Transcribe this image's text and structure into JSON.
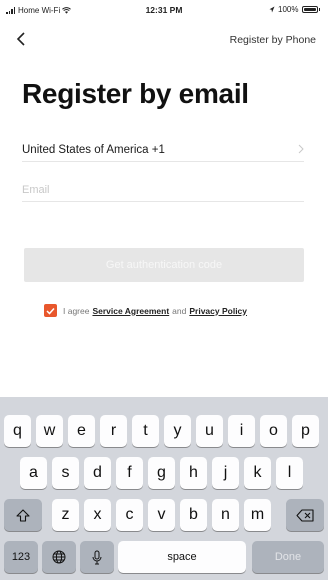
{
  "status_bar": {
    "carrier": "Home Wi-Fi",
    "time": "12:31 PM",
    "battery": "100%"
  },
  "nav": {
    "back_icon": "chevron-left-icon",
    "right_link": "Register by Phone"
  },
  "page": {
    "title": "Register by email"
  },
  "form": {
    "country": "United States of America +1",
    "email_placeholder": "Email",
    "email_value": "",
    "submit_label": "Get authentication code"
  },
  "agreement": {
    "checked": true,
    "prefix": "I agree",
    "service_link": "Service Agreement",
    "conjunction": "and",
    "privacy_link": "Privacy Policy"
  },
  "keyboard": {
    "row1": [
      "q",
      "w",
      "e",
      "r",
      "t",
      "y",
      "u",
      "i",
      "o",
      "p"
    ],
    "row2": [
      "a",
      "s",
      "d",
      "f",
      "g",
      "h",
      "j",
      "k",
      "l"
    ],
    "row3": [
      "z",
      "x",
      "c",
      "v",
      "b",
      "n",
      "m"
    ],
    "numbers_label": "123",
    "space_label": "space",
    "done_label": "Done"
  },
  "colors": {
    "accent": "#e8572c",
    "button_disabled": "#e6e6e6",
    "keyboard_bg": "#d3d6dc"
  }
}
